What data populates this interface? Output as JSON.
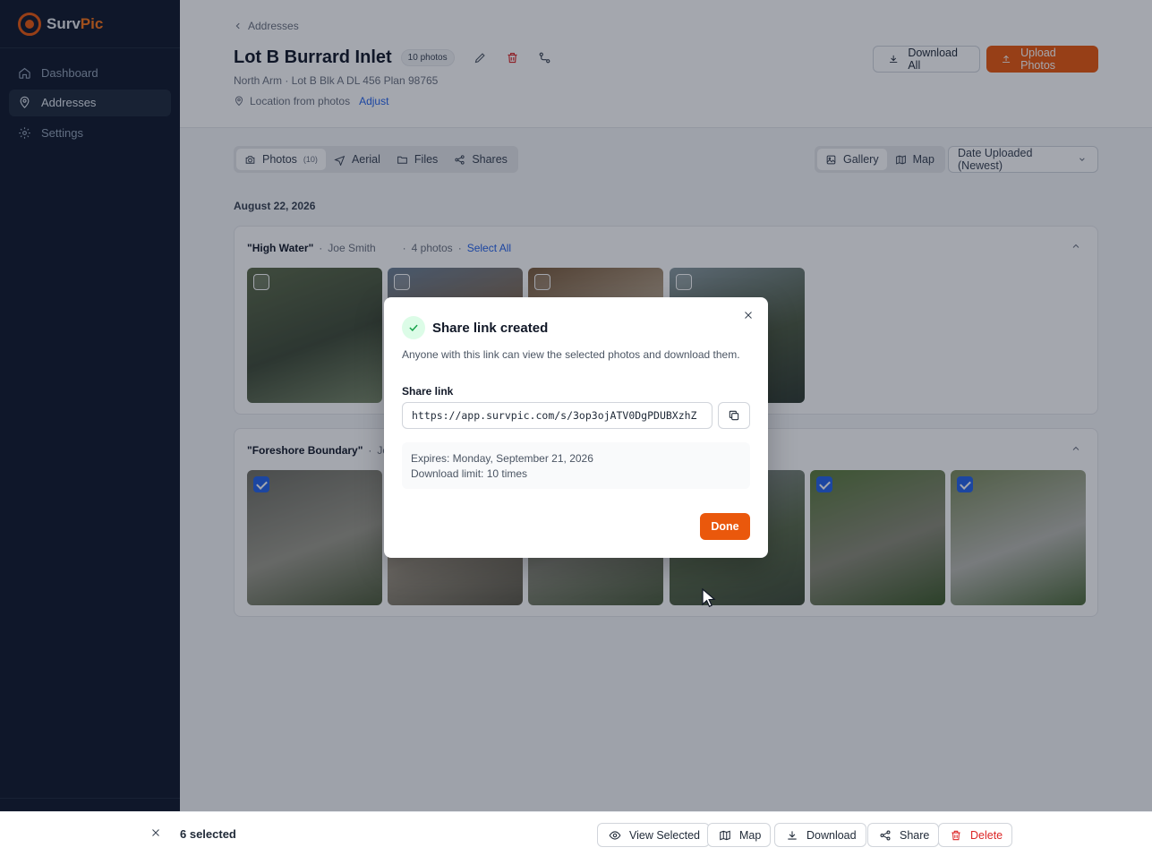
{
  "brand": {
    "name_a": "Surv",
    "name_b": "Pic"
  },
  "sidebar": {
    "items": [
      {
        "label": "Dashboard",
        "icon": "home-icon"
      },
      {
        "label": "Addresses",
        "icon": "map-pin-icon",
        "active": true
      },
      {
        "label": "Settings",
        "icon": "gear-icon"
      }
    ]
  },
  "header": {
    "breadcrumb": "Addresses",
    "title": "Lot B Burrard Inlet",
    "photo_badge": "10 photos",
    "subtitle": "North Arm · Lot B Blk A DL 456 Plan 98765",
    "location_text": "Location from photos",
    "adjust_link": "Adjust",
    "download_all": "Download All",
    "upload_photos": "Upload Photos"
  },
  "tabs": [
    {
      "label": "Photos",
      "count": "(10)",
      "icon": "camera-icon"
    },
    {
      "label": "Aerial",
      "icon": "plane-icon"
    },
    {
      "label": "Files",
      "icon": "folder-icon"
    },
    {
      "label": "Shares",
      "icon": "share-icon"
    }
  ],
  "view": {
    "gallery": "Gallery",
    "map": "Map",
    "sort": "Date Uploaded (Newest)"
  },
  "date_heading": "August 22, 2026",
  "groups": [
    {
      "name": "\"High Water\"",
      "user": "Joe Smith",
      "count": "4 photos",
      "select_all": "Select All",
      "thumbs": [
        {
          "colors": [
            "#5d6b4a",
            "#3f4a36",
            "#7a8a6a"
          ],
          "checked": false
        },
        {
          "colors": [
            "#6b7f94",
            "#8a6a4a",
            "#c9c3b5"
          ],
          "checked": false
        },
        {
          "colors": [
            "#7a5a3a",
            "#c8b8a0",
            "#5a4a38"
          ],
          "checked": false
        },
        {
          "colors": [
            "#8a9aa0",
            "#4d5a42",
            "#2f3a30"
          ],
          "checked": false
        }
      ]
    },
    {
      "name": "\"Foreshore Boundary\"",
      "user": "Joe",
      "thumbs": [
        {
          "colors": [
            "#6f6e63",
            "#9c9a8c",
            "#4d5a3a"
          ],
          "checked": true
        },
        {
          "colors": [
            "#7a6e5e",
            "#a09684",
            "#5a5646"
          ],
          "checked": true
        },
        {
          "colors": [
            "#6e7a5e",
            "#8c8c7c",
            "#4a5a3a"
          ],
          "checked": true
        },
        {
          "colors": [
            "#8e9498",
            "#5a6a4a",
            "#3e4a36"
          ],
          "checked": true
        },
        {
          "colors": [
            "#5a7a3a",
            "#8a8a78",
            "#3e5a2a"
          ],
          "checked": true
        },
        {
          "colors": [
            "#7a8a5a",
            "#b8b8b0",
            "#4e6a3a"
          ],
          "checked": true
        }
      ]
    }
  ],
  "modal": {
    "title": "Share link created",
    "description": "Anyone with this link can view the selected photos and download them.",
    "share_label": "Share link",
    "share_url": "https://app.survpic.com/s/3op3ojATV0DgPDUBXzhZ",
    "expires": "Expires: Monday, September 21, 2026",
    "download_limit": "Download limit: 10 times",
    "done": "Done"
  },
  "bottombar": {
    "selected": "6 selected",
    "view_selected": "View Selected",
    "map": "Map",
    "download": "Download",
    "share": "Share",
    "delete": "Delete"
  },
  "colors": {
    "accent": "#ea580c",
    "link": "#2563eb",
    "danger": "#dc2626",
    "sidebar": "#0f172a"
  }
}
